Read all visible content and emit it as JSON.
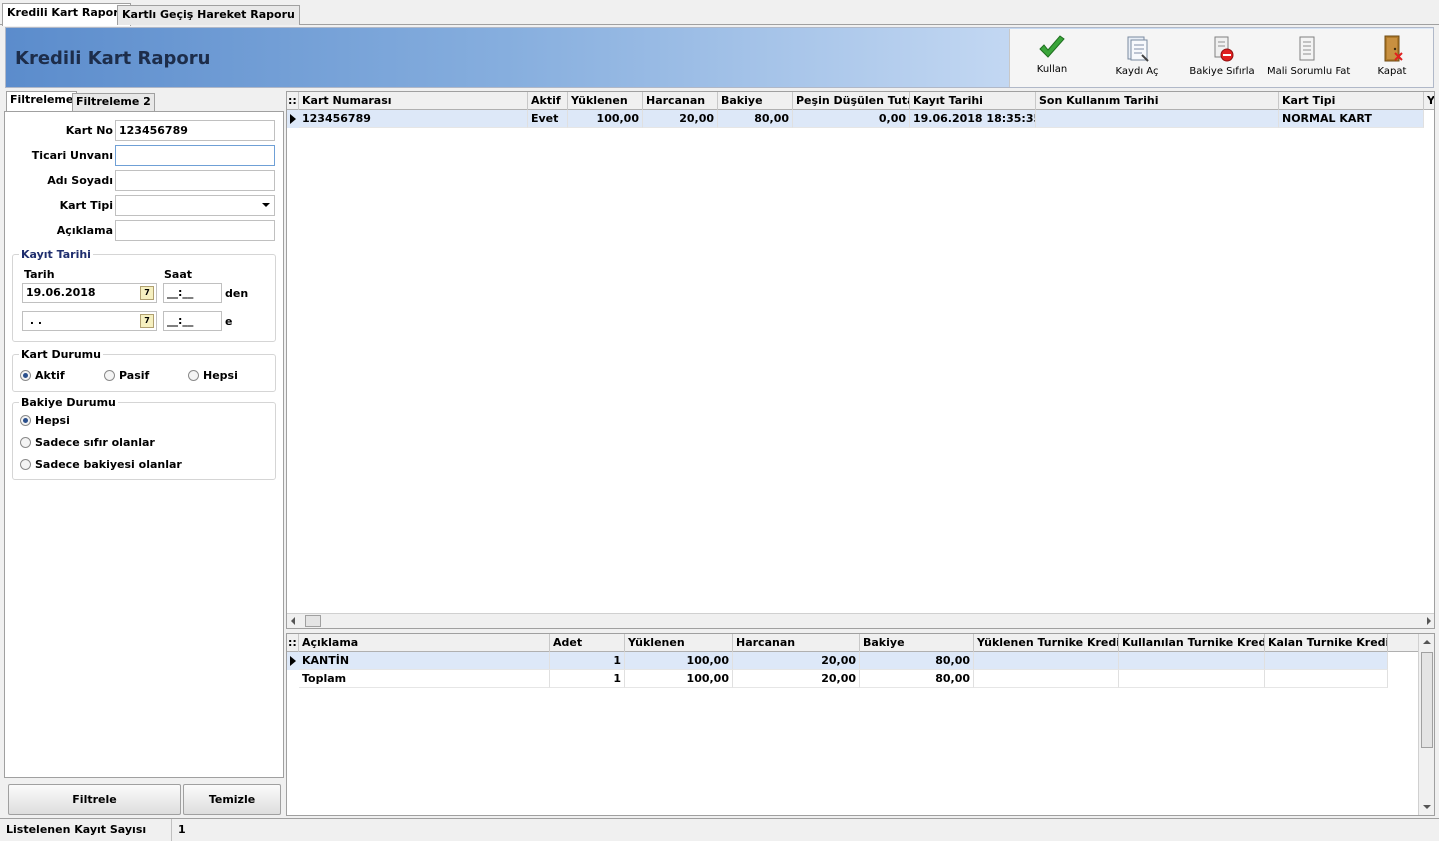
{
  "top_tabs": [
    {
      "label": "Kredili Kart Raporu",
      "active": true
    },
    {
      "label": "Kartlı Geçiş Hareket Raporu",
      "active": false
    }
  ],
  "header": {
    "title": "Kredili Kart Raporu"
  },
  "toolbar": {
    "kullan": {
      "label": "Kullan",
      "icon": "checkmark-icon"
    },
    "kaydi_ac": {
      "label": "Kaydı Aç",
      "icon": "open-record-icon"
    },
    "bakiye_sifirla": {
      "label": "Bakiye Sıfırla",
      "icon": "reset-balance-icon"
    },
    "mali_sorumlu_fat": {
      "label": "Mali Sorumlu Fat",
      "icon": "invoice-icon"
    },
    "kapat": {
      "label": "Kapat",
      "icon": "exit-door-icon"
    }
  },
  "filter_tabs": [
    {
      "label": "Filtreleme",
      "active": true
    },
    {
      "label": "Filtreleme 2",
      "active": false
    }
  ],
  "filters": {
    "kart_no": {
      "label": "Kart No",
      "value": "123456789"
    },
    "ticari_unvani": {
      "label": "Ticari Unvanı",
      "value": ""
    },
    "adi_soyadi": {
      "label": "Adı Soyadı",
      "value": ""
    },
    "kart_tipi": {
      "label": "Kart Tipi",
      "value": ""
    },
    "aciklama": {
      "label": "Açıklama",
      "value": ""
    }
  },
  "kayit_tarihi": {
    "title": "Kayıt Tarihi",
    "tarih_label": "Tarih",
    "saat_label": "Saat",
    "from_date": "19.06.2018",
    "from_time": "__:__",
    "from_suffix": "den",
    "to_date": " . .",
    "to_time": "__:__",
    "to_suffix": "e"
  },
  "kart_durumu": {
    "title": "Kart Durumu",
    "options": [
      "Aktif",
      "Pasif",
      "Hepsi"
    ],
    "selected": "Aktif"
  },
  "bakiye_durumu": {
    "title": "Bakiye Durumu",
    "options": [
      "Hepsi",
      "Sadece sıfır olanlar",
      "Sadece bakiyesi olanlar"
    ],
    "selected": "Hepsi"
  },
  "buttons": {
    "filtrele": "Filtrele",
    "temizle": "Temizle"
  },
  "main_grid": {
    "columns": [
      "Kart Numarası",
      "Aktif",
      "Yüklenen",
      "Harcanan",
      "Bakiye",
      "Peşin Düşülen Tutar",
      "Kayıt Tarihi",
      "Son Kullanım Tarihi",
      "Kart Tipi",
      "Y"
    ],
    "rows": [
      [
        "123456789",
        "Evet",
        "100,00",
        "20,00",
        "80,00",
        "0,00",
        "19.06.2018 18:35:35",
        "",
        "NORMAL KART",
        ""
      ]
    ]
  },
  "summary_grid": {
    "columns": [
      "Açıklama",
      "Adet",
      "Yüklenen",
      "Harcanan",
      "Bakiye",
      "Yüklenen Turnike Kredisi",
      "Kullanılan Turnike Kredisi",
      "Kalan Turnike Kredisi"
    ],
    "rows": [
      [
        "KANTİN",
        "1",
        "100,00",
        "20,00",
        "80,00",
        "",
        "",
        ""
      ],
      [
        "Toplam",
        "1",
        "100,00",
        "20,00",
        "80,00",
        "",
        "",
        ""
      ]
    ]
  },
  "status": {
    "label": "Listelenen Kayıt Sayısı",
    "value": "1"
  }
}
